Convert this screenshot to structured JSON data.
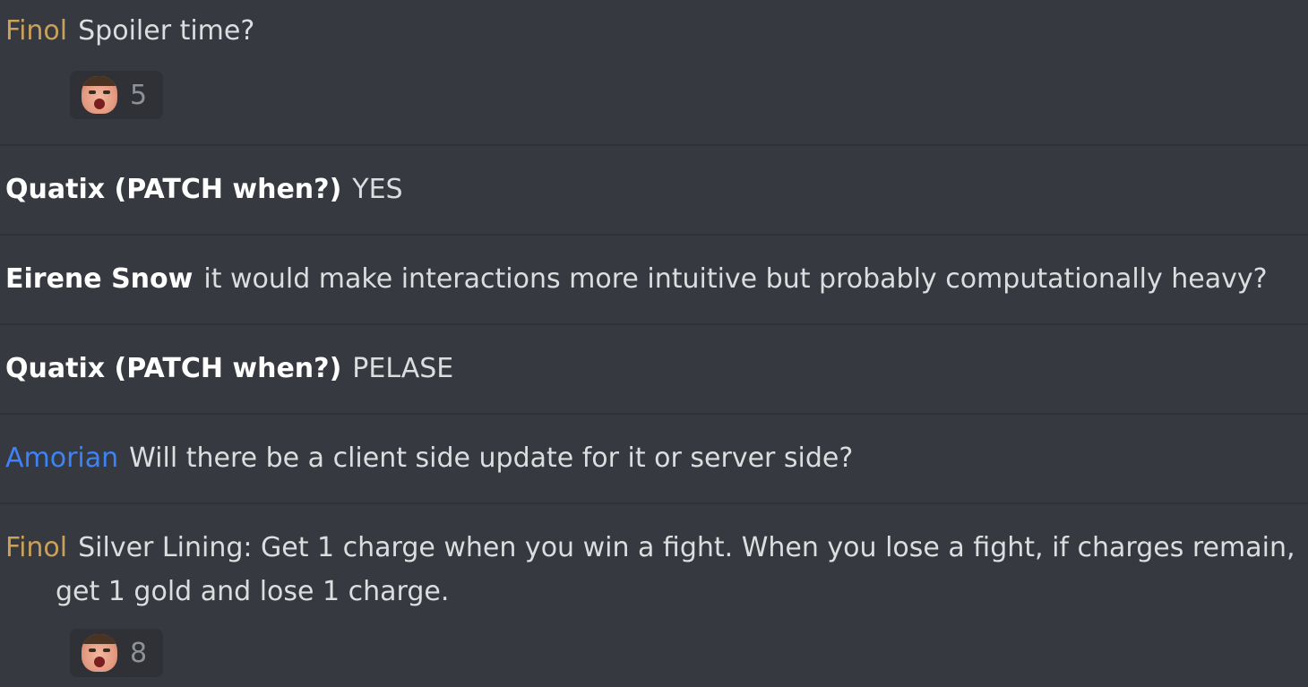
{
  "messages": [
    {
      "author": "Finol",
      "text": "Spoiler time?",
      "reaction": {
        "icon": "emote-face-icon",
        "count": "5"
      }
    },
    {
      "author": "Quatix (PATCH when?)",
      "text": "YES"
    },
    {
      "author": "Eirene Snow",
      "text": "it would make interactions more intuitive but probably computationally heavy?"
    },
    {
      "author": "Quatix (PATCH when?)",
      "text": "PELASE"
    },
    {
      "author": "Amorian",
      "text": "Will there be a client side update for it or server side?"
    },
    {
      "author": "Finol",
      "text": "Silver Lining: Get 1 charge when you win a fight. When you lose a fight, if charges remain,",
      "text_continued": "get 1 gold and lose 1 charge.",
      "reaction": {
        "icon": "emote-face-icon",
        "count": "8"
      }
    }
  ],
  "colors": {
    "background": "#36393f",
    "author_gold": "#c9a15a",
    "author_blue": "#3e82f7",
    "author_white": "#ffffff",
    "text": "#dcddde",
    "reaction_bg": "#2f3136",
    "count": "#8e9297"
  }
}
